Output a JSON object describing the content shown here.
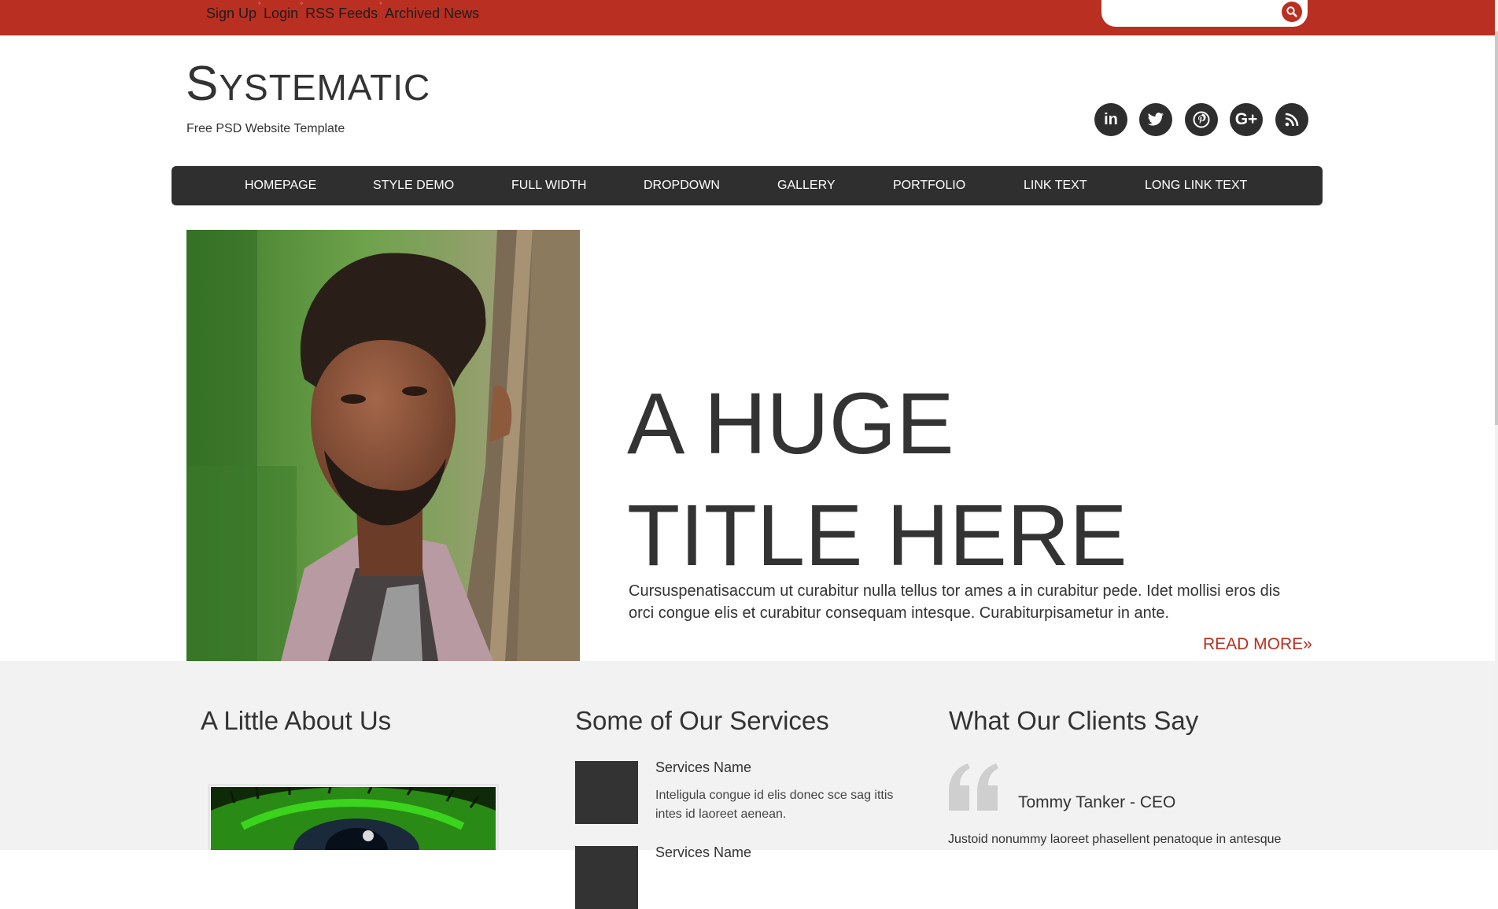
{
  "topbar": {
    "links": [
      "Sign Up",
      "Login",
      "RSS Feeds",
      "Archived News"
    ],
    "separator": "°",
    "search": {
      "value": "",
      "placeholder": ""
    }
  },
  "header": {
    "logo_first": "S",
    "logo_rest": "YSTEMATIC",
    "tagline": "Free PSD Website Template",
    "social": [
      {
        "name": "linkedin-icon",
        "glyph": "in"
      },
      {
        "name": "twitter-icon",
        "glyph": ""
      },
      {
        "name": "pinterest-icon",
        "glyph": "P"
      },
      {
        "name": "google-plus-icon",
        "glyph": "G+"
      },
      {
        "name": "rss-icon",
        "glyph": ""
      }
    ]
  },
  "nav": {
    "items": [
      "HOMEPAGE",
      "STYLE DEMO",
      "FULL WIDTH",
      "DROPDOWN",
      "GALLERY",
      "PORTFOLIO",
      "LINK TEXT",
      "LONG LINK TEXT"
    ]
  },
  "hero": {
    "title_line1": "A HUGE",
    "title_line2": "TITLE HERE",
    "text": "Cursuspenatisaccum ut curabitur nulla tellus tor ames a in curabitur pede. Idet mollisi eros dis orci congue elis et curabitur consequam intesque. Curabiturpisametur in ante.",
    "read_more": "READ MORE»"
  },
  "about": {
    "title": "A Little About Us"
  },
  "services": {
    "title": "Some of Our Services",
    "items": [
      {
        "name": "Services Name",
        "desc": "Inteligula congue id elis donec sce sag ittis intes id laoreet aenean."
      },
      {
        "name": "Services Name",
        "desc": ""
      }
    ]
  },
  "clients": {
    "title": "What Our Clients Say",
    "name": "Tommy Tanker - CEO",
    "text": "Justoid nonummy laoreet phasellent penatoque in antesque"
  },
  "colors": {
    "accent": "#b92f21",
    "dark": "#2f2f2f",
    "section_bg": "#f2f2f2"
  }
}
